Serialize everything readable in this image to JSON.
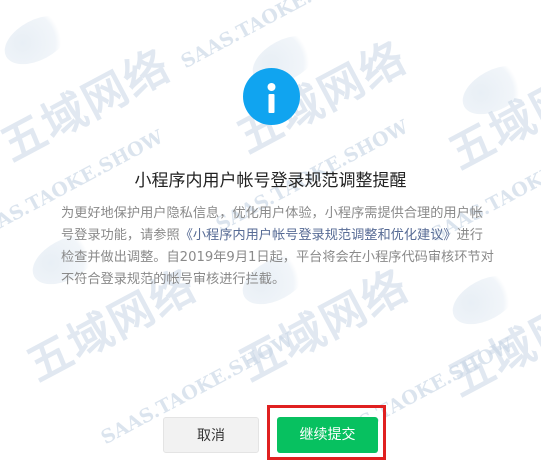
{
  "dialog": {
    "icon": "info-icon",
    "title": "小程序内用户帐号登录规范调整提醒",
    "body": {
      "text_before_link": "为更好地保护用户隐私信息，优化用户体验，小程序需提供合理的用户帐号登录功能，请参照",
      "link_text": "《小程序内用户帐号登录规范调整和优化建议》",
      "text_after_link": "进行检查并做出调整。自2019年9月1日起，平台将会在小程序代码审核环节对不符合登录规范的帐号审核进行拦截。"
    },
    "buttons": {
      "cancel_label": "取消",
      "continue_label": "继续提交"
    }
  },
  "watermark": {
    "logo_text": "五域网络",
    "url_text": "SAAS.TAOKE.SHOW"
  },
  "colors": {
    "icon_blue": "#10a4f0",
    "primary_green": "#07c160",
    "highlight_red": "#e02020",
    "link_blue": "#576b95",
    "watermark": "#c9d7e6"
  }
}
